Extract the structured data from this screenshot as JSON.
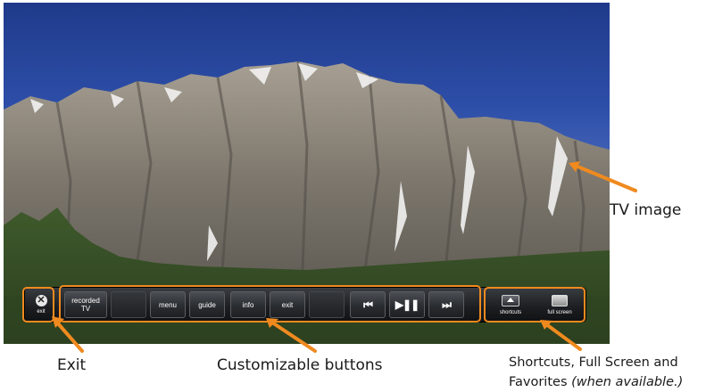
{
  "tv": {
    "label": "TV image"
  },
  "controls": {
    "exit": {
      "label": "exit"
    },
    "buttons": {
      "recorded_tv": {
        "line1": "recorded",
        "line2": "TV"
      },
      "menu": "menu",
      "guide": "guide",
      "info": "info",
      "exit": "exit"
    },
    "transport": {
      "previous": "⏮",
      "play_pause": "▶❚❚",
      "next": "⏭"
    },
    "shortcuts": {
      "label": "shortcuts"
    },
    "full_screen": {
      "label": "full screen"
    }
  },
  "captions": {
    "exit": "Exit",
    "customizable": "Customizable buttons",
    "shortcuts_line1": "Shortcuts, Full Screen and",
    "shortcuts_line2_prefix": "Favorites ",
    "shortcuts_line2_note": "(when available.)",
    "tv_image": "TV image"
  },
  "colors": {
    "highlight": "#f08a1f",
    "bar": "#1b1d20",
    "sky": "#2d4ea8"
  }
}
